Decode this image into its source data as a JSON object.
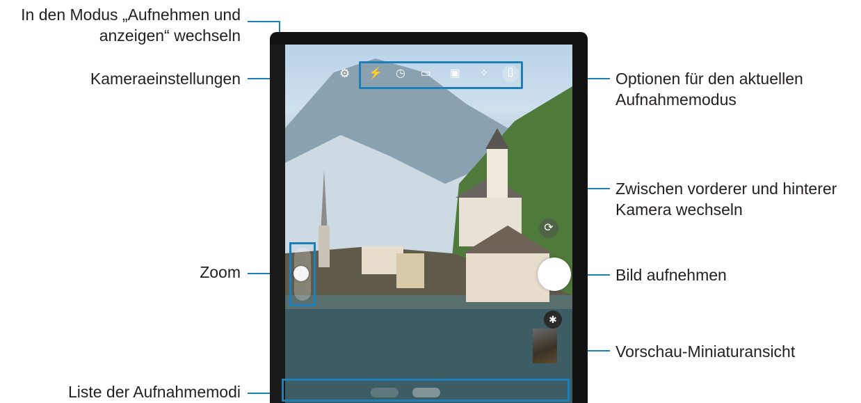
{
  "callouts": {
    "switch_mode_line1": "In den Modus „Aufnehmen und",
    "switch_mode_line2": "anzeigen“ wechseln",
    "camera_settings": "Kameraeinstellungen",
    "zoom": "Zoom",
    "mode_list": "Liste der Aufnahmemodi",
    "options_line1": "Optionen für den aktuellen",
    "options_line2": "Aufnahmemodus",
    "switch_camera_line1": "Zwischen vorderer und hinterer",
    "switch_camera_line2": "Kamera wechseln",
    "capture": "Bild aufnehmen",
    "preview": "Vorschau-Miniaturansicht"
  },
  "camera_options": [
    {
      "icon": "flash-icon",
      "glyph": "⚡"
    },
    {
      "icon": "timer-icon",
      "glyph": "◷"
    },
    {
      "icon": "aspect-ratio-icon",
      "glyph": "▭"
    },
    {
      "icon": "motion-photo-icon",
      "glyph": "▣"
    },
    {
      "icon": "filters-icon",
      "glyph": "✧"
    },
    {
      "icon": "split-view-icon",
      "glyph": "▯"
    }
  ],
  "colors": {
    "callout_line": "#1e7fb8",
    "text": "#231f20"
  }
}
